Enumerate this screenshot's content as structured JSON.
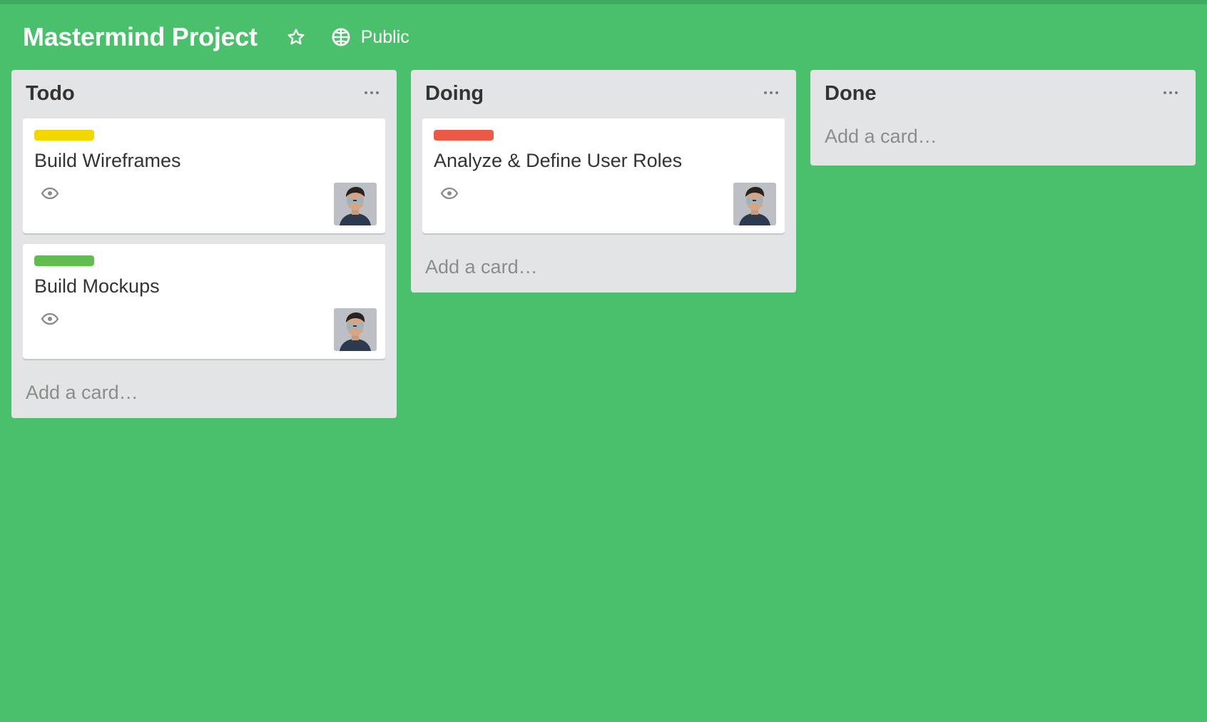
{
  "board": {
    "title": "Mastermind Project",
    "visibility": "Public",
    "background_color": "#4bc06c"
  },
  "icons": {
    "star": "star-icon",
    "visibility": "globe-icon",
    "list_menu": "ellipsis-icon",
    "watch": "eye-icon"
  },
  "lists": [
    {
      "title": "Todo",
      "cards": [
        {
          "title": "Build Wireframes",
          "label_color": "#f2d600"
        },
        {
          "title": "Build Mockups",
          "label_color": "#61bd4f"
        }
      ],
      "add_card": "Add a card…"
    },
    {
      "title": "Doing",
      "cards": [
        {
          "title": "Analyze & Define User Roles",
          "label_color": "#eb5a46"
        }
      ],
      "add_card": "Add a card…"
    },
    {
      "title": "Done",
      "cards": [],
      "add_card": "Add a card…"
    }
  ]
}
